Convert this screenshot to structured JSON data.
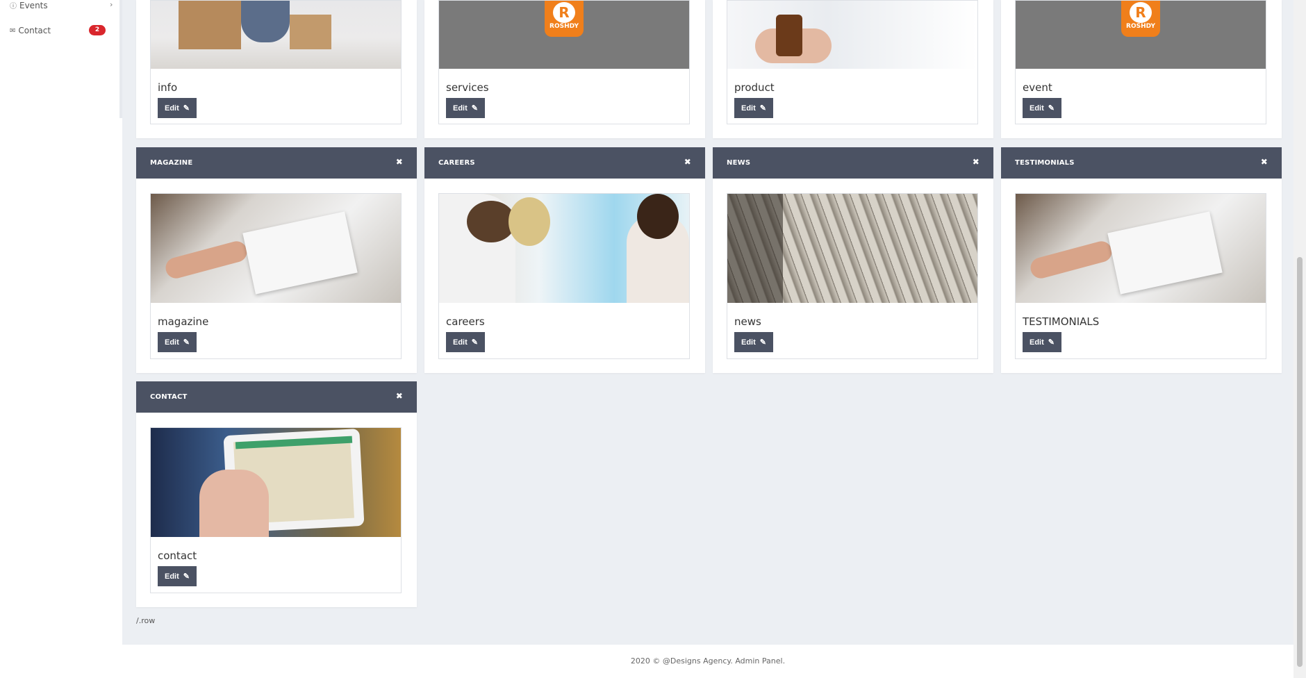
{
  "sidebar": {
    "items": [
      {
        "label": "Events",
        "icon": "info-circle-icon"
      },
      {
        "label": "Contact",
        "icon": "envelope-icon",
        "badge": "2"
      }
    ],
    "badge_color": "#d9262c"
  },
  "sections_top": [
    {
      "title": "info"
    },
    {
      "title": "services"
    },
    {
      "title": "product"
    },
    {
      "title": "event"
    }
  ],
  "cards": [
    {
      "header": "MAGAZINE",
      "title": "magazine"
    },
    {
      "header": "CAREERS",
      "title": "careers"
    },
    {
      "header": "NEWS",
      "title": "news"
    },
    {
      "header": "TESTIMONIALS",
      "title": "TESTIMONIALS"
    },
    {
      "header": "CONTACT",
      "title": "contact"
    }
  ],
  "buttons": {
    "edit": "Edit"
  },
  "logo_text": "ROSHDY",
  "row_comment": "/.row",
  "footer": {
    "text": "2020 © @Designs Agency. Admin Panel."
  },
  "colors": {
    "header_bg": "#4b5263",
    "page_bg": "#eceff3",
    "logo_orange": "#f07f1b"
  }
}
